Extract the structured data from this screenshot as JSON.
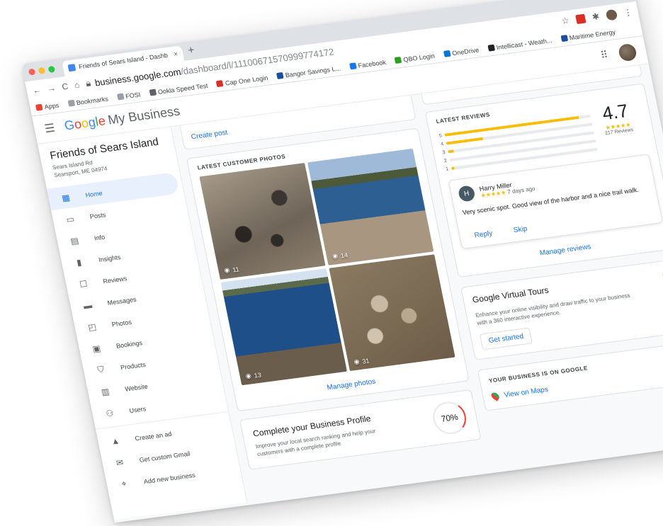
{
  "browser": {
    "tab_title": "Friends of Sears Island - Dashb",
    "close_glyph": "×",
    "new_tab_glyph": "+",
    "url_host": "business.google.com",
    "url_path": "/dashboard/l/11100671570999774172",
    "bookmarks": [
      {
        "label": "Apps",
        "color": "#ea4335"
      },
      {
        "label": "Bookmarks",
        "color": "#9aa0a6"
      },
      {
        "label": "FOSI",
        "color": "#9aa0a6"
      },
      {
        "label": "Ookla Speed Test",
        "color": "#5f6368"
      },
      {
        "label": "Cap One Login",
        "color": "#d93025"
      },
      {
        "label": "Bangor Savings L...",
        "color": "#1a4fa0"
      },
      {
        "label": "Facebook",
        "color": "#1877f2"
      },
      {
        "label": "QBO Login",
        "color": "#2ca01c"
      },
      {
        "label": "OneDrive",
        "color": "#0078d4"
      },
      {
        "label": "Intellicast - Weath...",
        "color": "#202124"
      },
      {
        "label": "Maritime Energy",
        "color": "#1a4fa0"
      }
    ]
  },
  "header": {
    "brand_google": "Google",
    "brand_rest": "My Business"
  },
  "business": {
    "name": "Friends of Sears Island",
    "address_line1": "Sears Island Rd",
    "address_line2": "Searsport, ME 04974"
  },
  "nav": [
    {
      "label": "Home",
      "icon": "home-icon",
      "glyph": "▦"
    },
    {
      "label": "Posts",
      "icon": "posts-icon",
      "glyph": "▭"
    },
    {
      "label": "Info",
      "icon": "info-icon",
      "glyph": "▤"
    },
    {
      "label": "Insights",
      "icon": "insights-icon",
      "glyph": "▮"
    },
    {
      "label": "Reviews",
      "icon": "reviews-icon",
      "glyph": "☐"
    },
    {
      "label": "Messages",
      "icon": "messages-icon",
      "glyph": "▬"
    },
    {
      "label": "Photos",
      "icon": "photos-icon",
      "glyph": "◰"
    },
    {
      "label": "Bookings",
      "icon": "bookings-icon",
      "glyph": "▣"
    },
    {
      "label": "Products",
      "icon": "products-icon",
      "glyph": "⛉"
    },
    {
      "label": "Website",
      "icon": "website-icon",
      "glyph": "▥"
    },
    {
      "label": "Users",
      "icon": "users-icon",
      "glyph": "⚇"
    }
  ],
  "nav_extra": [
    {
      "label": "Create an ad",
      "icon": "ads-icon",
      "glyph": "▲"
    },
    {
      "label": "Get custom Gmail",
      "icon": "gmail-icon",
      "glyph": "✉"
    },
    {
      "label": "Add new business",
      "icon": "location-icon",
      "glyph": "⌖"
    }
  ],
  "posts": {
    "create_post": "Create post"
  },
  "photos": {
    "heading": "LATEST CUSTOMER PHOTOS",
    "items": [
      {
        "views": "11"
      },
      {
        "views": "14"
      },
      {
        "views": "13"
      },
      {
        "views": "31"
      }
    ],
    "manage": "Manage photos"
  },
  "profile": {
    "title": "Complete your Business Profile",
    "desc": "Improve your local search ranking and help your customers with a complete profile",
    "percent": "70%"
  },
  "reviews": {
    "heading": "LATEST REVIEWS",
    "score": "4.7",
    "stars": "★★★★★",
    "count": "217 Reviews",
    "distribution": [
      {
        "star": "5",
        "fraction": 0.92
      },
      {
        "star": "4",
        "fraction": 0.25
      },
      {
        "star": "3",
        "fraction": 0.04
      },
      {
        "star": "2",
        "fraction": 0.0
      },
      {
        "star": "1",
        "fraction": 0.02
      }
    ],
    "latest": {
      "initial": "H",
      "name": "Harry Miller",
      "stars": "★★★★★",
      "when": "7 days ago",
      "text": "Very scenic spot. Good view of the harbor and a nice trail walk."
    },
    "reply": "Reply",
    "skip": "Skip",
    "manage": "Manage reviews"
  },
  "tours": {
    "title": "Google Virtual Tours",
    "desc": "Enhance your online visibility and draw traffic to your business with a 360 interactive experience.",
    "cta": "Get started"
  },
  "onmaps": {
    "heading": "YOUR BUSINESS IS ON GOOGLE",
    "link": "View on Maps"
  },
  "colors": {
    "accent": "#1a73e8",
    "star": "#fbbc04"
  }
}
